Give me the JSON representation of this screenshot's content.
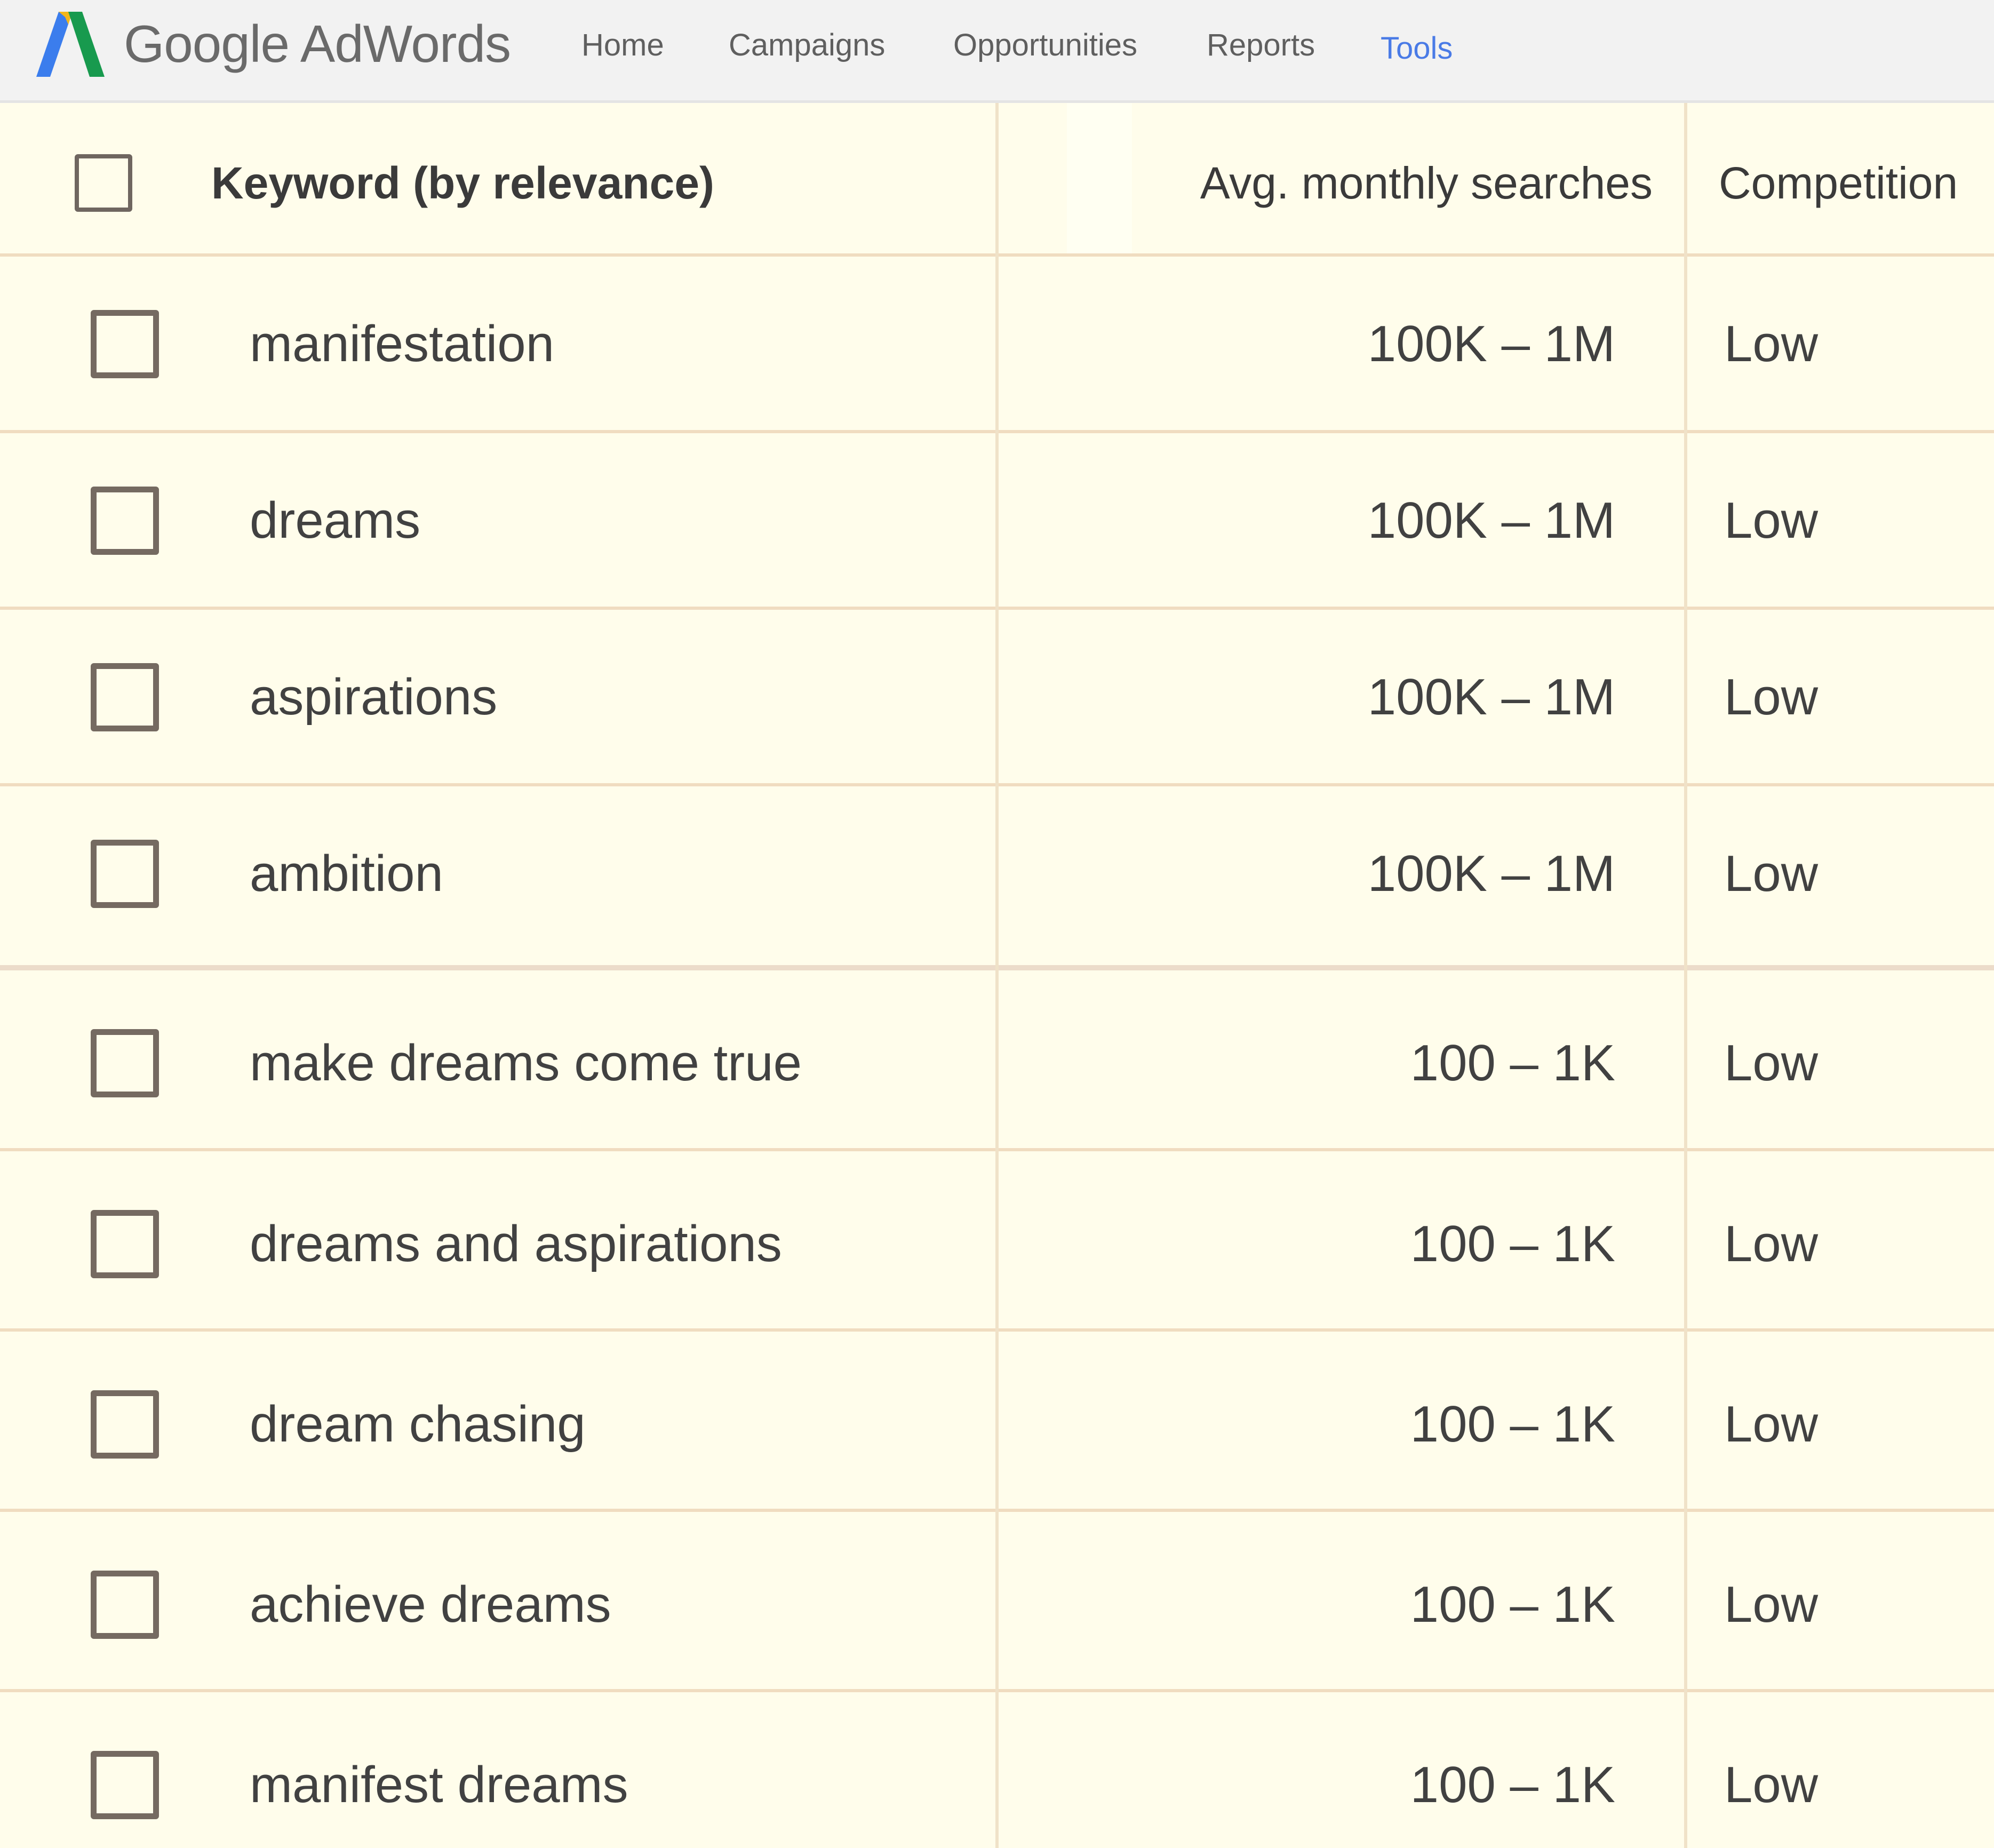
{
  "app": {
    "logo_text": "Google AdWords",
    "logo_icon": "adwords-logo-icon"
  },
  "nav": {
    "items": [
      {
        "label": "Home",
        "active": false
      },
      {
        "label": "Campaigns",
        "active": false
      },
      {
        "label": "Opportunities",
        "active": false
      },
      {
        "label": "Reports",
        "active": false
      },
      {
        "label": "Tools",
        "active": true
      }
    ],
    "active_color": "#4a7be6"
  },
  "table": {
    "columns": {
      "keyword": "Keyword (by relevance)",
      "searches": "Avg. monthly searches",
      "competition": "Competition"
    },
    "rows": [
      {
        "keyword": "manifestation",
        "searches": "100K – 1M",
        "competition": "Low"
      },
      {
        "keyword": "dreams",
        "searches": "100K – 1M",
        "competition": "Low"
      },
      {
        "keyword": "aspirations",
        "searches": "100K – 1M",
        "competition": "Low"
      },
      {
        "keyword": "ambition",
        "searches": "100K – 1M",
        "competition": "Low"
      },
      {
        "keyword": "make dreams come true",
        "searches": "100 – 1K",
        "competition": "Low"
      },
      {
        "keyword": "dreams and aspirations",
        "searches": "100 – 1K",
        "competition": "Low"
      },
      {
        "keyword": "dream chasing",
        "searches": "100 – 1K",
        "competition": "Low"
      },
      {
        "keyword": "achieve dreams",
        "searches": "100 – 1K",
        "competition": "Low"
      },
      {
        "keyword": "manifest dreams",
        "searches": "100 – 1K",
        "competition": "Low"
      }
    ]
  },
  "colors": {
    "background": "#fffdeb",
    "gridline": "#f0dcc0",
    "text": "#414141",
    "checkbox": "#756a61"
  }
}
